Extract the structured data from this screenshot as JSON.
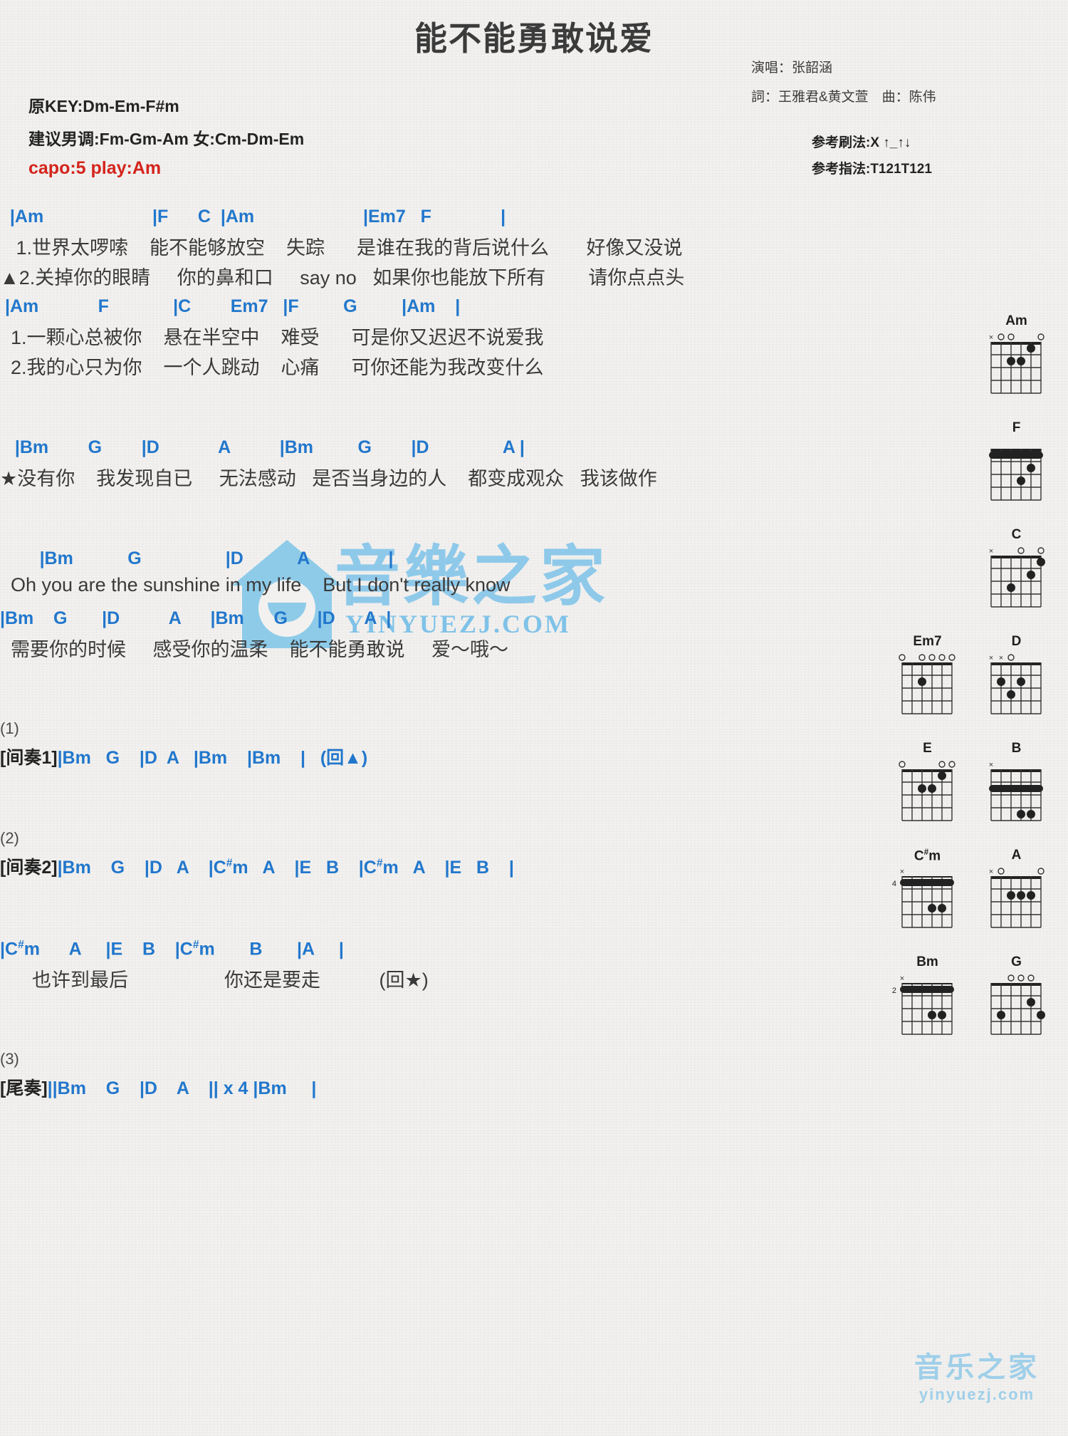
{
  "song": {
    "title": "能不能勇敢说爱",
    "artist_label": "演唱：张韶涵",
    "credits_label": "詞：王雅君&黄文萱　曲：陈伟",
    "original_key": "原KEY:Dm-Em-F#m",
    "suggested_key": "建议男调:Fm-Gm-Am 女:Cm-Dm-Em",
    "capo": "capo:5 play:Am",
    "strum_pattern": "参考刷法:X ↑_↑↓",
    "finger_pattern": "参考指法:T121T121"
  },
  "colors": {
    "chord": "#2277cc",
    "bar": "#8a5a2a",
    "lyric": "#3a3a3a",
    "capo": "#d4241c",
    "watermark": "#8ec9ea"
  },
  "sections": [
    {
      "name": "verse-1",
      "chordline": "  |Am                      |F      C  |Am                      |Em7   F              |",
      "lyrics": [
        "   1.世界太啰嗦    能不能够放空    失踪      是谁在我的背后说什么       好像又没说",
        "▲2.关掉你的眼睛     你的鼻和口     say no   如果你也能放下所有        请你点点头"
      ]
    },
    {
      "name": "verse-2",
      "chordline": " |Am            F             |C        Em7   |F         G         |Am    |",
      "lyrics": [
        "  1.一颗心总被你    悬在半空中    难受      可是你又迟迟不说爱我",
        "  2.我的心只为你    一个人跳动    心痛      可你还能为我改变什么"
      ]
    },
    {
      "name": "chorus-1",
      "chordline": "   |Bm        G        |D            A          |Bm         G        |D               A |",
      "lyrics": [
        "★没有你    我发现自已     无法感动   是否当身边的人    都变成观众   我该做作"
      ]
    },
    {
      "name": "chorus-2",
      "chordline": "        |Bm           G                 |D           A                |",
      "lyrics": [
        "  Oh you are the sunshine in my life    But I don't really know"
      ]
    },
    {
      "name": "chorus-3",
      "chordline": "|Bm    G       |D          A      |Bm      G      |D      A  |",
      "lyrics": [
        "  需要你的时候     感受你的温柔    能不能勇敢说     爱～哦～"
      ]
    }
  ],
  "interludes": [
    {
      "number": "(1)",
      "label": "[间奏1]",
      "content": "|Bm   G    |D  A   |Bm    |Bm    |   (回▲)"
    },
    {
      "number": "(2)",
      "label": "[间奏2]",
      "content": "|Bm    G    |D   A    |C#m   A    |E   B    |C#m   A    |E   B    |"
    }
  ],
  "bridge": {
    "name": "bridge",
    "chordline": "|C#m      A     |E    B    |C#m       B       |A     |",
    "lyrics": [
      "      也许到最后                  你还是要走           (回★)"
    ]
  },
  "outro": {
    "number": "(3)",
    "label": "[尾奏]",
    "content": "||Bm    G    |D    A    || x 4 |Bm     |"
  },
  "chord_diagrams": [
    {
      "name": "Am",
      "baseFret": "",
      "markers": "x00210",
      "dots": [
        [
          2,
          2
        ],
        [
          3,
          2
        ],
        [
          4,
          1
        ]
      ]
    },
    {
      "name": "F",
      "baseFret": "",
      "markers": "133211",
      "barre": 1,
      "dots": [
        [
          3,
          3
        ],
        [
          4,
          2
        ]
      ]
    },
    {
      "name": "C",
      "baseFret": "",
      "markers": "x32010",
      "dots": [
        [
          2,
          3
        ],
        [
          4,
          2
        ],
        [
          5,
          1
        ]
      ]
    },
    {
      "name": "Em7",
      "baseFret": "",
      "markers": "020000",
      "dots": [
        [
          2,
          2
        ]
      ]
    },
    {
      "name": "D",
      "baseFret": "",
      "markers": "xx0232",
      "dots": [
        [
          3,
          2
        ],
        [
          1,
          2
        ],
        [
          2,
          3
        ]
      ]
    },
    {
      "name": "E",
      "baseFret": "",
      "markers": "022100",
      "dots": [
        [
          2,
          2
        ],
        [
          3,
          2
        ],
        [
          4,
          1
        ]
      ]
    },
    {
      "name": "B",
      "baseFret": "",
      "markers": "x24442",
      "barre": 2,
      "dots": [
        [
          3,
          4
        ],
        [
          4,
          4
        ]
      ]
    },
    {
      "name": "C#m",
      "baseFret": "4",
      "markers": "x46654",
      "barre": 1,
      "dots": [
        [
          3,
          3
        ],
        [
          4,
          3
        ]
      ]
    },
    {
      "name": "A",
      "baseFret": "",
      "markers": "x02220",
      "dots": [
        [
          2,
          2
        ],
        [
          3,
          2
        ],
        [
          4,
          2
        ]
      ]
    },
    {
      "name": "Bm",
      "baseFret": "2",
      "markers": "x24432",
      "barre": 1,
      "dots": [
        [
          3,
          3
        ],
        [
          4,
          3
        ]
      ]
    },
    {
      "name": "G",
      "baseFret": "",
      "markers": "320003",
      "dots": [
        [
          5,
          3
        ],
        [
          4,
          2
        ],
        [
          1,
          3
        ]
      ]
    }
  ],
  "watermarks": {
    "center_cn": "音樂之家",
    "center_en": "YINYUEZJ.COM",
    "corner_cn": "音乐之家",
    "corner_en": "yinyuezj.com"
  }
}
